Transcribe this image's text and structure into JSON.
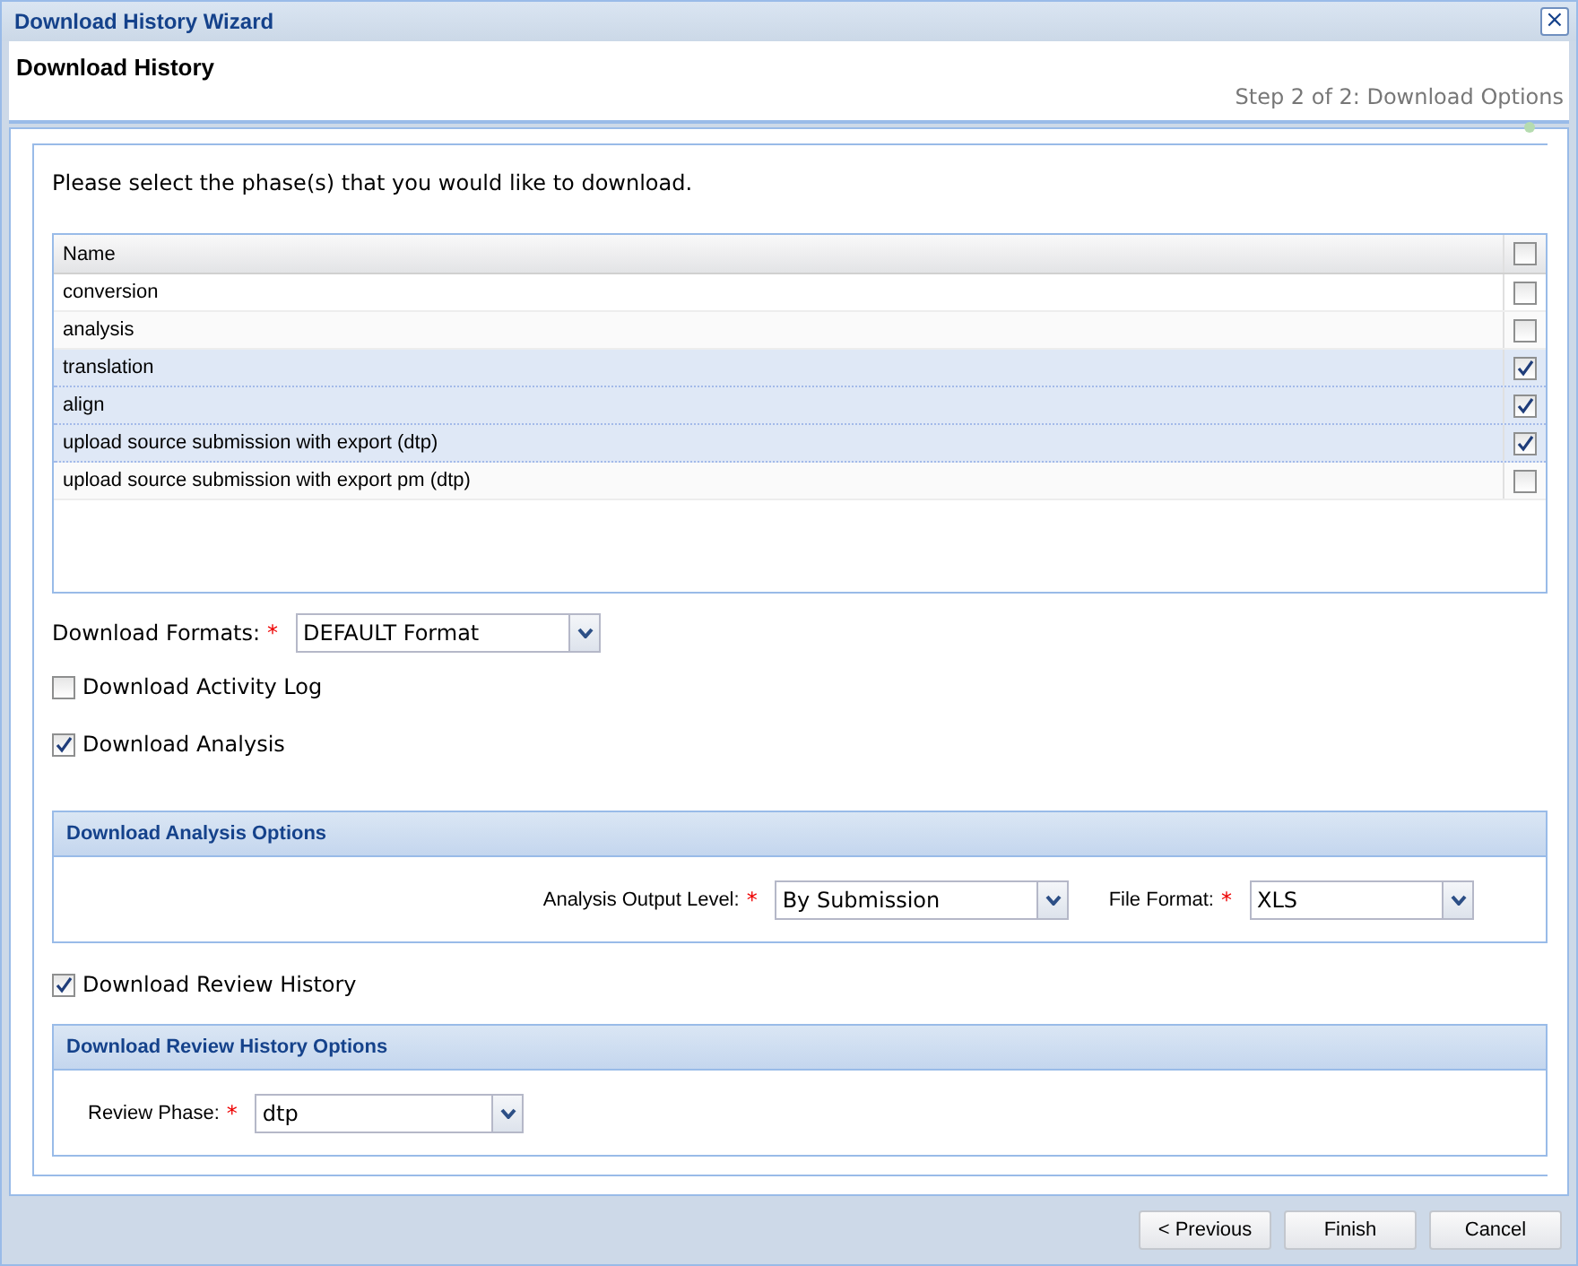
{
  "window": {
    "title": "Download History Wizard",
    "close": "×"
  },
  "header": {
    "title": "Download History",
    "step": "Step 2 of 2: Download Options"
  },
  "instruction": "Please select the phase(s) that you would like to download.",
  "phases": {
    "columns": [
      "Name"
    ],
    "all_checked": false,
    "rows": [
      {
        "name": "conversion",
        "checked": false
      },
      {
        "name": "analysis",
        "checked": false
      },
      {
        "name": "translation",
        "checked": true
      },
      {
        "name": "align",
        "checked": true
      },
      {
        "name": "upload source submission with export (dtp)",
        "checked": true
      },
      {
        "name": "upload source submission with export pm (dtp)",
        "checked": false
      }
    ]
  },
  "download_formats": {
    "label": "Download Formats:",
    "mark": "*",
    "value": "DEFAULT Format"
  },
  "options": [
    {
      "label": "Download Activity Log",
      "checked": false
    },
    {
      "label": "Download Analysis",
      "checked": true
    }
  ],
  "analysis_panel": {
    "title": "Download Analysis Options",
    "fields": [
      {
        "label": "Analysis Output Level:",
        "mark": "*",
        "value": "By Submission"
      },
      {
        "label": "File Format:",
        "mark": "*",
        "value": "XLS"
      }
    ]
  },
  "review_option": {
    "label": "Download Review History",
    "checked": true
  },
  "review_panel": {
    "title": "Download Review History Options",
    "fields": [
      {
        "label": "Review Phase:",
        "mark": "*",
        "value": "dtp"
      }
    ]
  },
  "buttons": [
    {
      "label": "< Previous"
    },
    {
      "label": "Finish"
    },
    {
      "label": "Cancel"
    }
  ]
}
